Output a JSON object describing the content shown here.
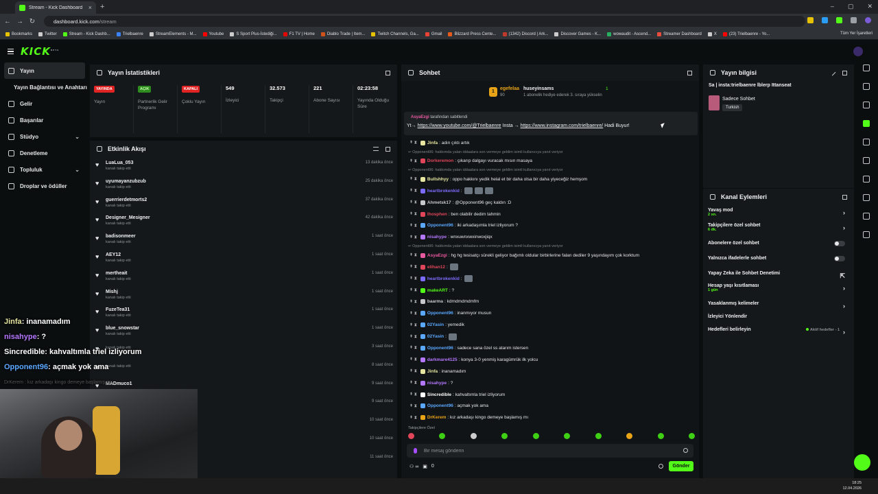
{
  "browser": {
    "tab_title": "Stream - Kick Dashboard",
    "url_host": "dashboard.kick.com",
    "url_path": "/stream",
    "bookmarks": [
      {
        "label": "Bookmarks",
        "color": "#e6c200"
      },
      {
        "label": "Twitter",
        "color": "#cccccc"
      },
      {
        "label": "Stream - Kick Dashb...",
        "color": "#53fc18"
      },
      {
        "label": "Trielbaenre",
        "color": "#3b82f6"
      },
      {
        "label": "StreamElements - M...",
        "color": "#cccccc"
      },
      {
        "label": "Youtube",
        "color": "#ff0000"
      },
      {
        "label": "S Sport Plus-İstediği...",
        "color": "#cccccc"
      },
      {
        "label": "F1 TV | Home",
        "color": "#e10600"
      },
      {
        "label": "Diablo Trade | Item...",
        "color": "#d0521b"
      },
      {
        "label": "Twitch Channels, Ga...",
        "color": "#e6c200"
      },
      {
        "label": "Gmail",
        "color": "#ea4335"
      },
      {
        "label": "Blizzard Press Cente...",
        "color": "#e85a1b"
      },
      {
        "label": "(1342) Discord | Ark...",
        "color": "#c0392b"
      },
      {
        "label": "Discover Games - K...",
        "color": "#cccccc"
      },
      {
        "label": "wowaudit - Ascend...",
        "color": "#27ae60"
      },
      {
        "label": "Streamer Dashboard",
        "color": "#e74c3c"
      },
      {
        "label": "X",
        "color": "#cccccc"
      },
      {
        "label": "(23) Trielbaenre - Yo...",
        "color": "#ff0000"
      }
    ],
    "bookmarks_all": "Tüm Yer İşaretleri"
  },
  "logo": "KICK",
  "logo_tag": "BETA",
  "sidebar": {
    "items": [
      {
        "label": "Yayın",
        "active": true
      },
      {
        "label": "Yayın Bağlantısı ve Anahtarı",
        "sub": true
      },
      {
        "label": "Gelir"
      },
      {
        "label": "Başarılar"
      },
      {
        "label": "Stüdyo",
        "chevron": true
      },
      {
        "label": "Denetleme"
      },
      {
        "label": "Topluluk",
        "chevron": true
      },
      {
        "label": "Droplar ve ödüller"
      }
    ]
  },
  "stats": {
    "title": "Yayın İstatistikleri",
    "items": [
      {
        "badge": "YAYINDA",
        "badge_color": "red",
        "label": "Yayın"
      },
      {
        "badge": "AÇIK",
        "badge_color": "green",
        "label": "Partnerlik Gelir Programı"
      },
      {
        "badge": "KAPALI",
        "badge_color": "red",
        "label": "Çoklu Yayın"
      },
      {
        "value": "549",
        "label": "İzleyici"
      },
      {
        "value": "32.573",
        "label": "Takipçi"
      },
      {
        "value": "221",
        "label": "Abone Sayısı"
      },
      {
        "value": "02:23:58",
        "label": "Yayında Olduğu Süre"
      }
    ]
  },
  "activity": {
    "title": "Etkinlik Akışı",
    "events": [
      {
        "name": "LuaLua_053",
        "action": "kanalı takip etti",
        "time": "13 dakika önce"
      },
      {
        "name": "uyumayanzubzub",
        "action": "kanalı takip etti",
        "time": "25 dakika önce"
      },
      {
        "name": "guerrierdetmorts2",
        "action": "kanalı takip etti",
        "time": "37 dakika önce"
      },
      {
        "name": "Designer_Mesigner",
        "action": "kanalı takip etti",
        "time": "42 dakika önce"
      },
      {
        "name": "badisonmeer",
        "action": "kanalı takip etti",
        "time": "1 saat önce"
      },
      {
        "name": "AEY12",
        "action": "kanalı takip etti",
        "time": "1 saat önce"
      },
      {
        "name": "mertheait",
        "action": "kanalı takip etti",
        "time": "1 saat önce"
      },
      {
        "name": "Mishj",
        "action": "kanalı takip etti",
        "time": "1 saat önce"
      },
      {
        "name": "FuzeTea31",
        "action": "kanalı takip etti",
        "time": "1 saat önce"
      },
      {
        "name": "blue_snowstar",
        "action": "kanalı takip etti",
        "time": "1 saat önce"
      },
      {
        "name": "",
        "action": "kanalı takip etti",
        "time": "3 saat önce"
      },
      {
        "name": "",
        "action": "kanalı takip etti",
        "time": "8 saat önce"
      },
      {
        "name": "MADmuco1",
        "action": "",
        "time": "9 saat önce"
      },
      {
        "name": "",
        "action": "",
        "time": "9 saat önce"
      },
      {
        "name": "",
        "action": "",
        "time": "10 saat önce"
      },
      {
        "name": "",
        "action": "",
        "time": "10 saat önce"
      },
      {
        "name": "",
        "action": "",
        "time": "11 saat önce"
      }
    ]
  },
  "chat": {
    "title": "Sohbet",
    "leader": {
      "rank": "1",
      "name": "egefelaa",
      "points": "90",
      "user": "huseyinsams",
      "count": "1",
      "sub_text": "1 abonelik hediye ederek 3. sıraya yükselin"
    },
    "pinned_by_user": "AsyaEzgi",
    "pinned_by_suffix": "tarafından sabitlendi",
    "pinned_parts": [
      {
        "text": "Yt→ "
      },
      {
        "text": "https://www.youtube.com/@Trielbaenre",
        "link": true
      },
      {
        "text": " Insta → "
      },
      {
        "text": "https://www.instagram.com/trielbaenre/",
        "link": true
      },
      {
        "text": " Hadi Buyur!"
      }
    ],
    "messages": [
      {
        "user": "Jinfa",
        "color": "#e6e6a0",
        "text": "adın çıktı artık"
      },
      {
        "sys": "Opponent96: hakkımda yalan iddaalara son vermeye geldim isimli kullanıcıya yanıt veriyor"
      },
      {
        "user": "Dorkeremon",
        "color": "#e0455a",
        "text": "çıkarıp dalgayı vuracak mısın masaya"
      },
      {
        "sys": "Opponent96: hakkımda yalan iddaalara son vermeye geldim isimli kullanıcıya yanıt veriyor"
      },
      {
        "user": "Bullshhyy",
        "color": "#e6e6a0",
        "text": "oppo hakkını yedik helal et bir daha olsa bir daha yiyeceğiz hemşom"
      },
      {
        "user": "heartbrokenkid",
        "color": "#7c6cff",
        "text": "",
        "emotes": 3
      },
      {
        "user": "Ahmetsk17",
        "color": "#c6c8cb",
        "text": "@Opponent96 geç kaldın :D"
      },
      {
        "user": "lhosphen",
        "color": "#e0455a",
        "text": "ben olabilir dedim tahmin"
      },
      {
        "user": "Opponent96",
        "color": "#5aa8ff",
        "text": "iki arkadaşımla triel izliyorum ?"
      },
      {
        "user": "nisahype",
        "color": "#b477ff",
        "text": "wnxuwnxwxinwoxjiqx"
      },
      {
        "sys": "Opponent96: hakkımda yalan iddaalara son vermeye geldim isimli kullanıcıya yanıt veriyor"
      },
      {
        "user": "AsyaEzgi",
        "color": "#e85aa0",
        "text": "hg hg tesisatçı sürekli geliyor bağımlı oldular birbirlerine falan dediler 9 yaşındayım çok korktum"
      },
      {
        "user": "elihan12",
        "color": "#e0455a",
        "text": "",
        "emotes": 1
      },
      {
        "user": "heartbrokenkid",
        "color": "#7c6cff",
        "text": "",
        "emotes": 1
      },
      {
        "user": "makeART",
        "color": "#53fc18",
        "text": "?"
      },
      {
        "user": "baarma",
        "color": "#c6c8cb",
        "text": "kdmdmdmdmfm"
      },
      {
        "user": "Opponent96",
        "color": "#5aa8ff",
        "text": "inanmıyor musun"
      },
      {
        "user": "02Yasin",
        "color": "#5aa8ff",
        "text": "yemedik"
      },
      {
        "user": "02Yasin",
        "color": "#5aa8ff",
        "text": "",
        "emotes": 1
      },
      {
        "user": "Opponent96",
        "color": "#5aa8ff",
        "text": "sadece sana özel ss atarım istersen"
      },
      {
        "user": "darkmare4125",
        "color": "#b477ff",
        "text": "konya 3-0 yenmiş karagümrük ilk yolcu"
      },
      {
        "user": "Jinfa",
        "color": "#e6e6a0",
        "text": "inanamadım"
      },
      {
        "user": "nisahype",
        "color": "#b477ff",
        "text": "?"
      },
      {
        "user": "Sincredible",
        "color": "#ffffff",
        "text": "kahvaltımla triel izliyorum"
      },
      {
        "user": "Opponent96",
        "color": "#5aa8ff",
        "text": "açmak yok ama"
      },
      {
        "user": "DrKerem",
        "color": "#e8a317",
        "text": "kız arkadaşı kingo demeye başlamış mı"
      }
    ],
    "footer_label": "Takipçilere Özel",
    "input_placeholder": "Bir mesaj gönderin",
    "points": "0",
    "send_label": "Gönder"
  },
  "info": {
    "title": "Yayın bilgisi",
    "stream_title": "Sa | insta:trielbaenre lblerp Ittanseat",
    "category": "Sadece Sohbet",
    "language": "Turkish"
  },
  "actions": {
    "title": "Kanal Eylemleri",
    "items": [
      {
        "label": "Yavaş mod",
        "sub": "2 sn.",
        "kind": "arrow"
      },
      {
        "label": "Takipçilere özel sohbet",
        "sub": "6 dk.",
        "kind": "arrow"
      },
      {
        "label": "Abonelere özel sohbet",
        "kind": "toggle"
      },
      {
        "label": "Yalnızca ifadelerle sohbet",
        "kind": "toggle"
      },
      {
        "label": "Yapay Zeka ile Sohbet Denetimi",
        "kind": "link"
      },
      {
        "label": "Hesap yaşı kısıtlaması",
        "sub": "1 gün",
        "kind": "arrow"
      },
      {
        "label": "Yasaklanmış kelimeler",
        "kind": "arrow"
      },
      {
        "label": "İzleyici Yönlendir",
        "kind": "none"
      },
      {
        "label": "Hedefleri belirleyin",
        "goal": "Aktif hedefler - 1",
        "kind": "arrow"
      }
    ]
  },
  "overlay": [
    {
      "user": "Jinfa",
      "text": ": inanamadım"
    },
    {
      "user": "nisahype",
      "text": ": ?"
    },
    {
      "user": "Sincredible",
      "text": ": kahvaltımla triel izliyorum"
    },
    {
      "user": "Opponent96",
      "text": ": açmak yok ama"
    },
    {
      "ghost": "DrKerem : kız arkadaşı kingo demeye başlamış mı"
    }
  ],
  "clock": {
    "time": "18:25",
    "date": "12.04.2026"
  }
}
